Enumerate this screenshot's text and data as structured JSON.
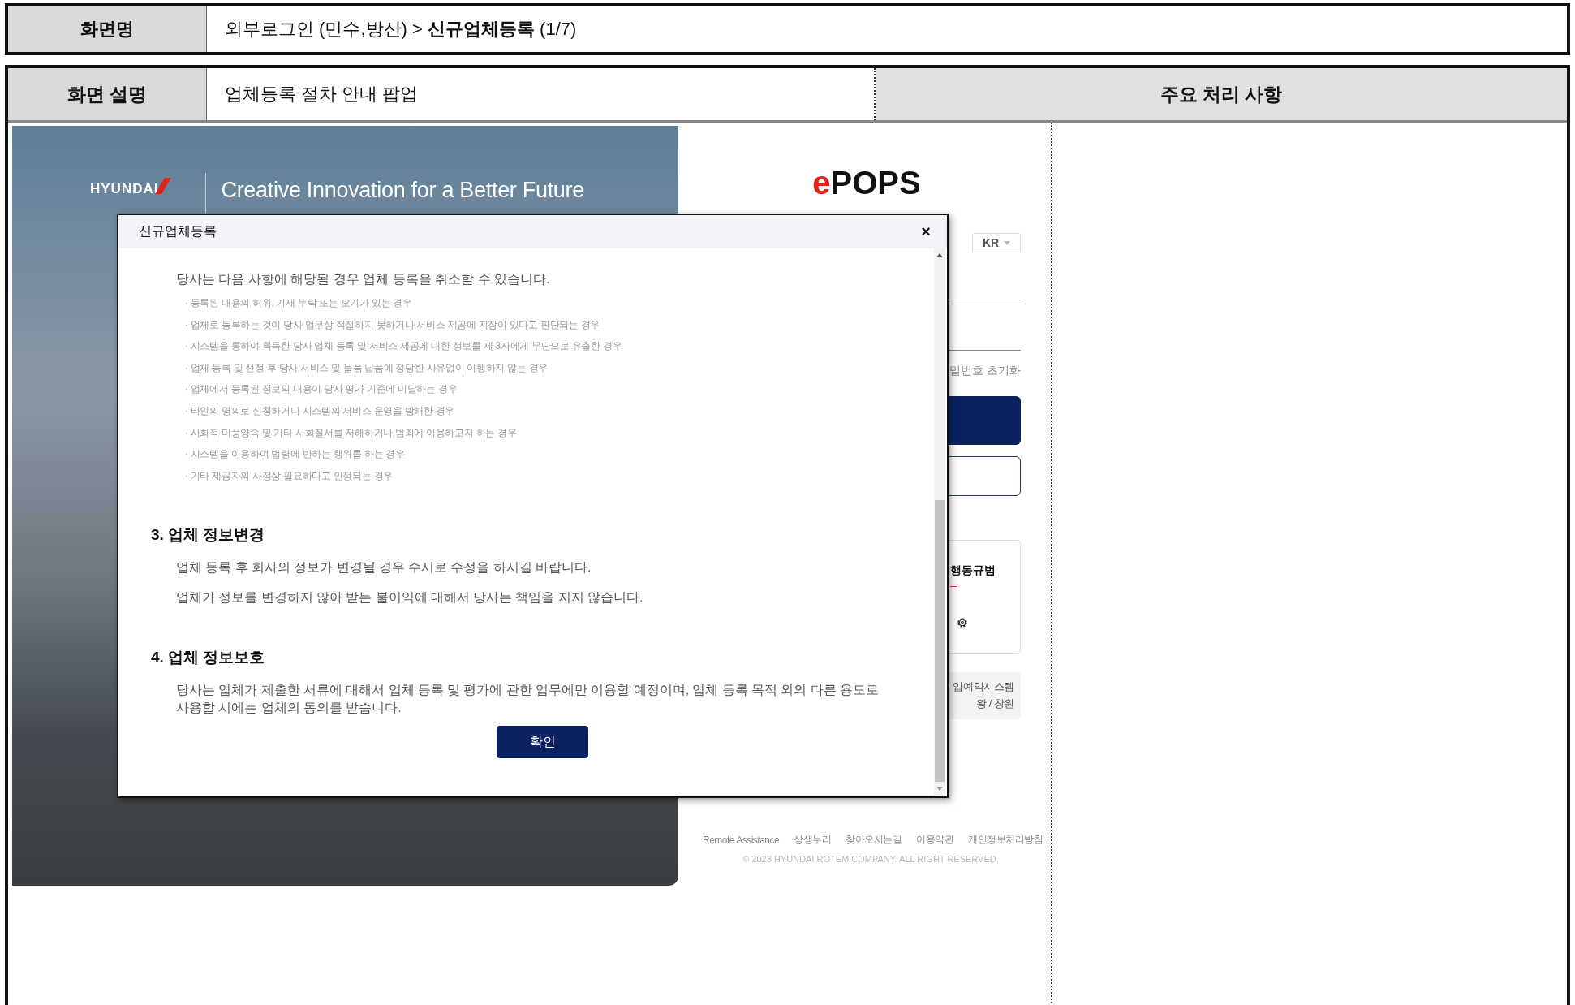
{
  "header": {
    "label": "화면명",
    "path": "외부로그인 (민수,방산) > **신규업체등록** (1/7)"
  },
  "description": {
    "label": "화면 설명",
    "value": "업체등록 절차 안내 팝업",
    "notes_header": "주요 처리 사항"
  },
  "screenshot": {
    "hero": {
      "logo_text": "HYUNDAI",
      "slogan": "Creative Innovation for a Better Future"
    },
    "login": {
      "brand_prefix": "e",
      "brand": "POPS",
      "language": "KR",
      "reset_link": "밀번호 초기화",
      "card_title": "행동규범",
      "info_lines": [
        "입예약시스템",
        "왕 / 창원"
      ],
      "footer_links": [
        "Remote Assistance",
        "상생누리",
        "찾아오시는길",
        "이용약관",
        "개인정보처리방침"
      ],
      "copyright": "© 2023 HYUNDAI ROTEM COMPANY. ALL RIGHT RESERVED."
    },
    "popup": {
      "title": "신규업체등록",
      "close": "×",
      "intro": "당사는 다음 사항에 해당될 경우 업체 등록을 취소할 수 있습니다.",
      "items": [
        "· 등록된 내용의 허위, 기재 누락 또는 오기가 있는 경우",
        "· 업체로 등록하는 것이 당사 업무상 적절하지 못하거나 서비스 제공에 지장이 있다고 판단되는 경우",
        "· 시스템을 통하여 획득한 당사 업체 등록 및 서비스 제공에 대한 정보를 제 3자에게 무단으로 유출한 경우",
        "· 업체 등록 및 선정 후 당사 서비스 및 물품 납품에 정당한 사유없이 이행하지 않는 경우",
        "· 업체에서 등록된 정보의 내용이 당사 평가 기준에 미달하는 경우",
        "· 타인의 명의로 신청하거나 시스템의 서비스 운영을 방해한 경우",
        "· 사회적 미풍양속 및 기타 사회질서를 저해하거나 범죄에 이용하고자 하는 경우",
        "· 시스템을 이용하여 법령에 반하는 행위를 하는 경우",
        "· 기타 제공자의 사정상 필요하다고 인정되는 경우"
      ],
      "sections": [
        {
          "heading": "3. 업체 정보변경",
          "paragraphs": [
            "업체 등록 후 회사의 정보가 변경될 경우 수시로 수정을 하시길 바랍니다.",
            "업체가 정보를 변경하지 않아 받는 불이익에 대해서 당사는 책임을 지지 않습니다."
          ]
        },
        {
          "heading": "4. 업체 정보보호",
          "paragraphs": [
            "당사는 업체가 제출한 서류에 대해서 업체 등록 및 평가에 관한 업무에만 이용할 예정이며, 업체 등록 목적 외의 다른 용도로 사용할 시에는 업체의 동의를 받습니다."
          ]
        }
      ],
      "confirm": "확인"
    }
  }
}
